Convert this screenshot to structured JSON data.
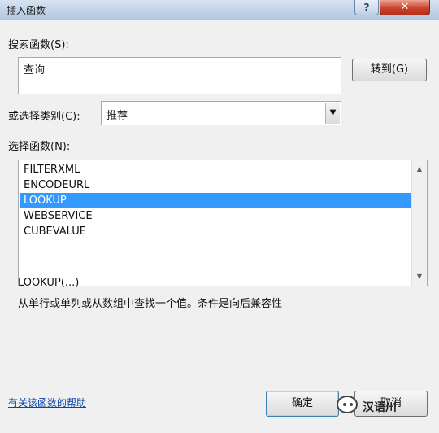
{
  "window": {
    "title": "插入函数",
    "help_glyph": "?",
    "close_glyph": "✕"
  },
  "search": {
    "label": "搜索函数(S):",
    "value": "查询",
    "go_button": "转到(G)"
  },
  "category": {
    "label": "或选择类别(C):",
    "selected": "推荐",
    "arrow_glyph": "▼"
  },
  "functions": {
    "label": "选择函数(N):",
    "items": [
      "FILTERXML",
      "ENCODEURL",
      "LOOKUP",
      "WEBSERVICE",
      "CUBEVALUE"
    ],
    "selected_index": 2,
    "scroll_up_glyph": "▲",
    "scroll_down_glyph": "▼"
  },
  "description": {
    "signature": "LOOKUP(...)",
    "text": "从单行或单列或从数组中查找一个值。条件是向后兼容性"
  },
  "footer": {
    "help_link": "有关该函数的帮助",
    "ok_button": "确定",
    "cancel_button": "取消"
  },
  "watermark": {
    "text": "汉语川"
  },
  "colors": {
    "selection": "#3399ff",
    "link": "#0645ad",
    "close_button": "#c9432d"
  }
}
